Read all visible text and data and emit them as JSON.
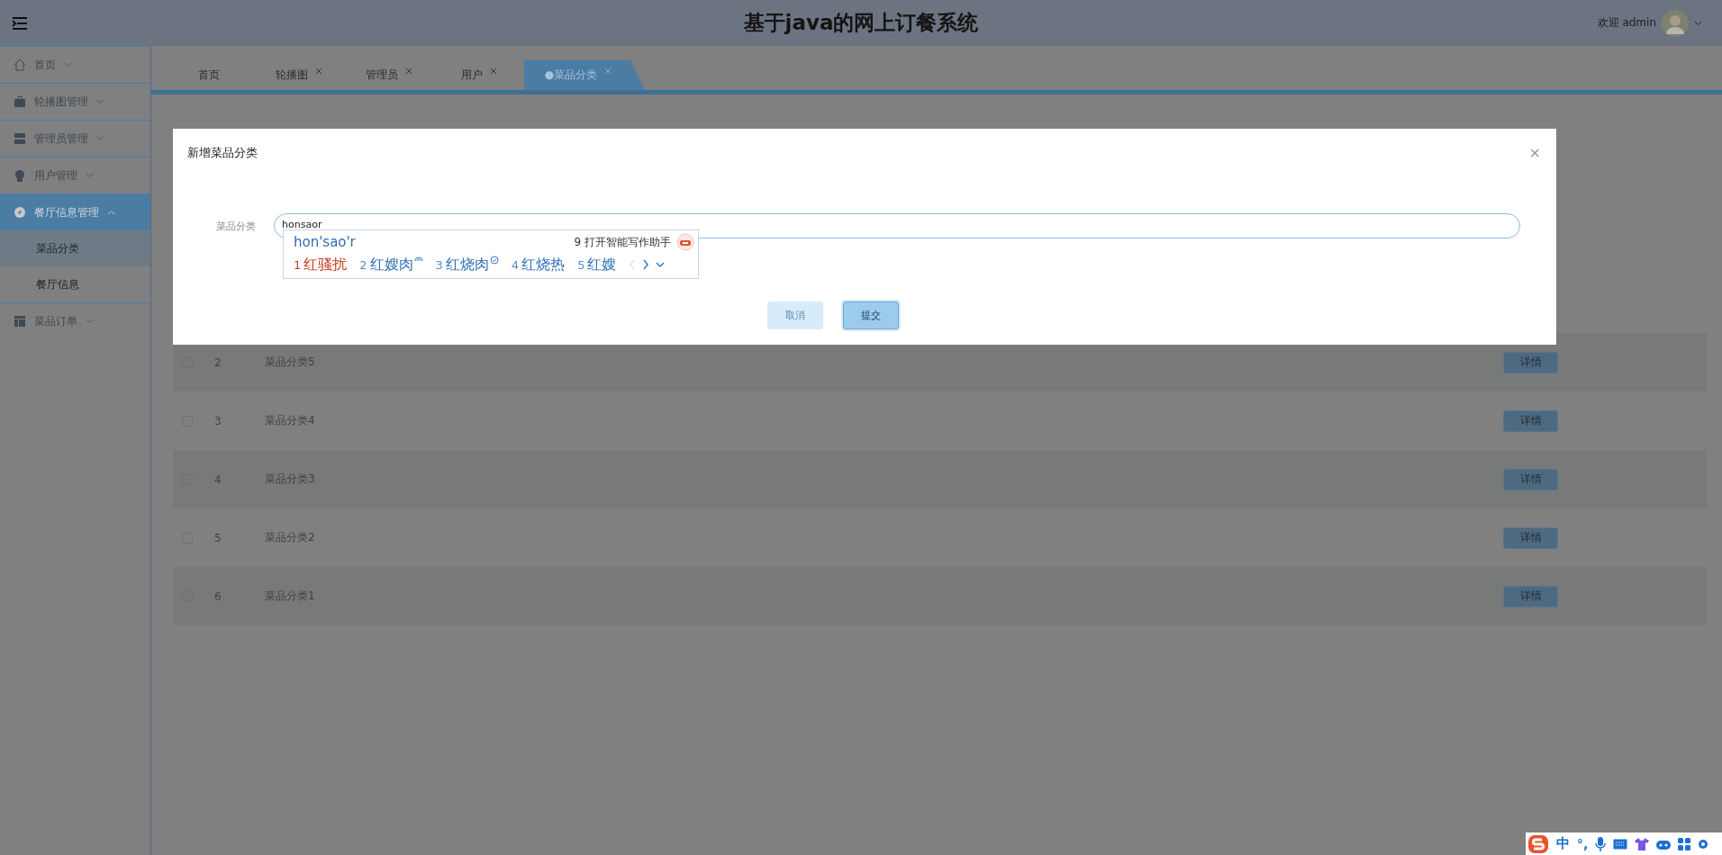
{
  "header": {
    "title": "基于java的网上订餐系统",
    "greeting": "欢迎 admin"
  },
  "sidebar": {
    "items": [
      {
        "label": "首页",
        "selected": false,
        "expanded": false
      },
      {
        "label": "轮播图管理",
        "selected": false,
        "expanded": false
      },
      {
        "label": "管理员管理",
        "selected": false,
        "expanded": false
      },
      {
        "label": "用户管理",
        "selected": false,
        "expanded": false
      },
      {
        "label": "餐厅信息管理",
        "selected": true,
        "expanded": true,
        "children": [
          {
            "label": "菜品分类",
            "selected": true
          },
          {
            "label": "餐厅信息",
            "selected": false
          }
        ]
      },
      {
        "label": "菜品订单",
        "selected": false,
        "expanded": false
      }
    ]
  },
  "tabs": [
    {
      "label": "首页",
      "closable": false,
      "selected": false
    },
    {
      "label": "轮播图",
      "closable": true,
      "selected": false
    },
    {
      "label": "管理员",
      "closable": true,
      "selected": false
    },
    {
      "label": "用户",
      "closable": true,
      "selected": false
    },
    {
      "label": "●菜品分类",
      "closable": true,
      "selected": true
    }
  ],
  "table": {
    "rows": [
      {
        "index": "2",
        "name": "菜品分类5",
        "checked": false,
        "action": "详情"
      },
      {
        "index": "3",
        "name": "菜品分类4",
        "checked": false,
        "action": "详情"
      },
      {
        "index": "4",
        "name": "菜品分类3",
        "checked": false,
        "action": "详情"
      },
      {
        "index": "5",
        "name": "菜品分类2",
        "checked": false,
        "action": "详情"
      },
      {
        "index": "6",
        "name": "菜品分类1",
        "checked": false,
        "action": "详情"
      }
    ]
  },
  "dialog": {
    "title": "新增菜品分类",
    "close": "×",
    "field_label": "菜品分类",
    "value": "honsaor",
    "ime": {
      "composition": "hon'sao'r",
      "assistant_number": "9",
      "assistant": "打开智能写作助手",
      "candidates": [
        {
          "number": "1",
          "text": "红骚扰",
          "selected": true,
          "kind": "plain"
        },
        {
          "number": "2",
          "text": "红嫂肉",
          "selected": false,
          "kind": "swirl"
        },
        {
          "number": "3",
          "text": "红烧肉",
          "selected": false,
          "kind": "check"
        },
        {
          "number": "4",
          "text": "红烧热",
          "selected": false,
          "kind": "plain"
        },
        {
          "number": "5",
          "text": "红嫂",
          "selected": false,
          "kind": "plain"
        }
      ]
    },
    "buttons": [
      {
        "label": "取消",
        "kind": "cancel"
      },
      {
        "label": "提交",
        "kind": "submit"
      }
    ]
  },
  "ime_bar": {
    "mode": "中",
    "punctuation": "°,"
  }
}
